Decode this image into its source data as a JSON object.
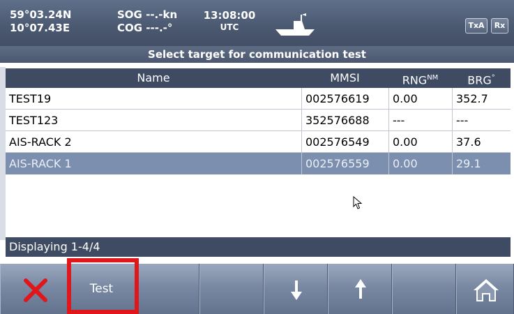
{
  "header": {
    "lat": "59°03.24N",
    "lon": "10°07.43E",
    "sog": "SOG --.-kn",
    "cog": "COG ---.-°",
    "time": "13:08:00",
    "time_zone": "UTC",
    "txa_label": "TxA",
    "rx_label": "Rx",
    "ship_icon": "own-ship-icon"
  },
  "title": "Select target for communication test",
  "table": {
    "columns": {
      "name": "Name",
      "mmsi": "MMSI",
      "rng": "RNG",
      "rng_unit": "NM",
      "brg": "BRG",
      "brg_unit": "°"
    },
    "rows": [
      {
        "name": "TEST19",
        "mmsi": "002576619",
        "rng": "0.00",
        "brg": "352.7"
      },
      {
        "name": "TEST123",
        "mmsi": "352576688",
        "rng": "---",
        "brg": "---"
      },
      {
        "name": "AIS-RACK 2",
        "mmsi": "002576549",
        "rng": "0.00",
        "brg": "37.6"
      },
      {
        "name": "AIS-RACK 1",
        "mmsi": "002576559",
        "rng": "0.00",
        "brg": "29.1"
      }
    ],
    "selected_row": 4
  },
  "status": "Displaying 1-4/4",
  "toolbar": {
    "close_icon": "close-icon",
    "test_label": "Test",
    "down_icon": "arrow-down-icon",
    "up_icon": "arrow-up-icon",
    "home_icon": "home-icon"
  },
  "colors": {
    "header_bg": "#4a5870",
    "table_header_bg": "#3e4b62",
    "selected_row_bg": "#7d8fae",
    "close_red": "#e0161b",
    "highlight_red": "#e0161b"
  }
}
